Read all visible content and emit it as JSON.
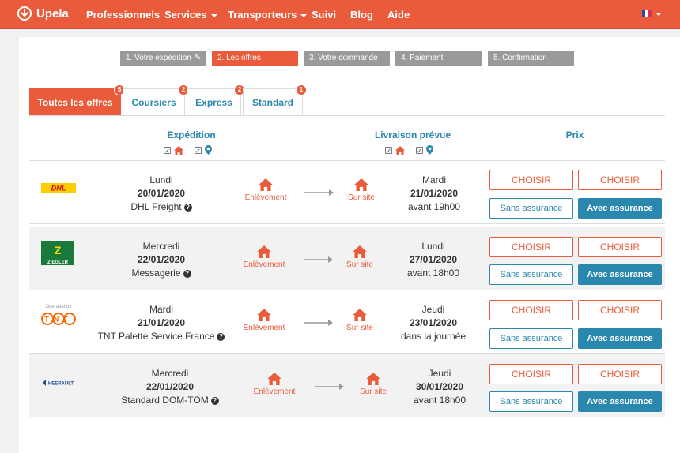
{
  "nav": {
    "brand": "Upela",
    "items": [
      "Professionnels",
      "Services",
      "Transporteurs",
      "Suivi",
      "Blog",
      "Aide"
    ],
    "flag_colors": [
      "#2c4a9c",
      "#ffffff",
      "#d8334a"
    ]
  },
  "steps": [
    "1. Votre expédition",
    "2. Les offres",
    "3. Votre commande",
    "4. Paiement",
    "5. Confirmation"
  ],
  "tabs": [
    {
      "label": "Toutes les offres",
      "count": "5"
    },
    {
      "label": "Coursiers",
      "count": "2"
    },
    {
      "label": "Express",
      "count": "2"
    },
    {
      "label": "Standard",
      "count": "1"
    }
  ],
  "headers": {
    "expedition": "Expédition",
    "livraison": "Livraison prévue",
    "prix": "Prix"
  },
  "buttons": {
    "choose": "CHOISIR",
    "sans": "Sans assurance",
    "avec": "Avec assurance"
  },
  "labels": {
    "pickup": "Enlèvement",
    "onsite": "Sur site"
  },
  "offers": [
    {
      "carrier": "DHL",
      "ship_day": "Lundi",
      "ship_date": "20/01/2020",
      "service": "DHL Freight",
      "del_day": "Mardi",
      "del_date": "21/01/2020",
      "del_time": "avant 19h00"
    },
    {
      "carrier": "ZIEGLER",
      "ship_day": "Mercredi",
      "ship_date": "22/01/2020",
      "service": "Messagerie",
      "del_day": "Lundi",
      "del_date": "27/01/2020",
      "del_time": "avant 18h00"
    },
    {
      "carrier": "TNT",
      "carrier_note": "Operated by",
      "ship_day": "Mardi",
      "ship_date": "21/01/2020",
      "service": "TNT Palette Service France",
      "del_day": "Jeudi",
      "del_date": "23/01/2020",
      "del_time": "dans la journée"
    },
    {
      "carrier": "HEERAULT",
      "ship_day": "Mercredi",
      "ship_date": "22/01/2020",
      "service": "Standard DOM-TOM",
      "del_day": "Jeudi",
      "del_date": "30/01/2020",
      "del_time": "avant 18h00"
    }
  ],
  "colors": {
    "accent": "#ea5b3c",
    "blue": "#2a87ad"
  }
}
